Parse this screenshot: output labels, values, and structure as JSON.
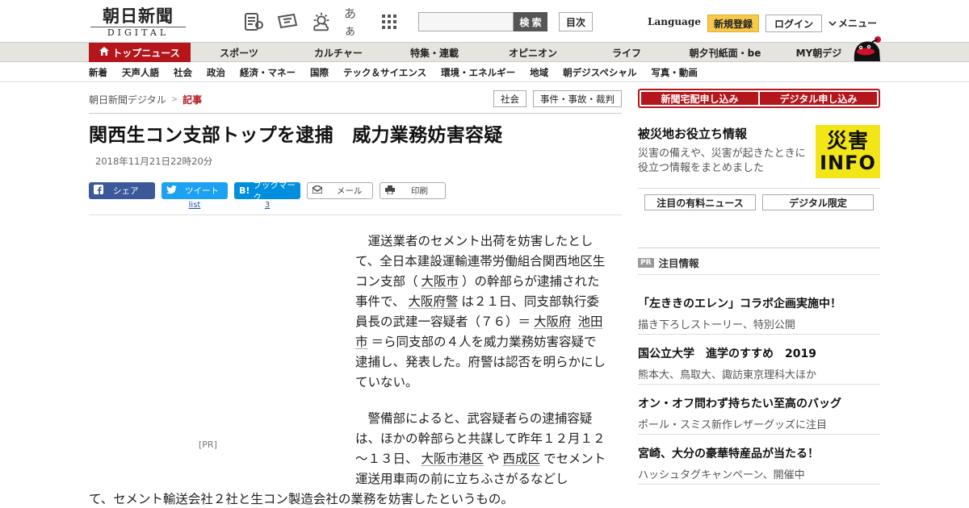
{
  "header": {
    "logo_main": "朝日新聞",
    "logo_sub": "DIGITAL",
    "search_button": "検 索",
    "index_button": "目次",
    "language": "Language",
    "signup": "新規登録",
    "login": "ログイン",
    "menu": "メニュー",
    "icon_font_label": "あぁ"
  },
  "nav_primary": [
    {
      "label": "トップニュース",
      "active": true
    },
    {
      "label": "スポーツ"
    },
    {
      "label": "カルチャー"
    },
    {
      "label": "特集・連載"
    },
    {
      "label": "オピニオン"
    },
    {
      "label": "ライフ"
    },
    {
      "label": "朝夕刊紙面・be"
    },
    {
      "label": "MY朝デジ"
    }
  ],
  "nav_secondary": [
    "新着",
    "天声人語",
    "社会",
    "政治",
    "経済・マネー",
    "国際",
    "テック＆サイエンス",
    "環境・エネルギー",
    "地域",
    "朝デジスペシャル",
    "写真・動画"
  ],
  "breadcrumb": {
    "home": "朝日新聞デジタル",
    "sep": ">",
    "current": "記事"
  },
  "category_tags": [
    "社会",
    "事件・事故・裁判"
  ],
  "article": {
    "headline": "関西生コン支部トップを逮捕　威力業務妨害容疑",
    "date": "2018年11月21日22時20分",
    "share": {
      "facebook": "シェア",
      "twitter": "ツイート",
      "twitter_count": "list",
      "hatena": "ブックマーク",
      "hatena_count": "3",
      "mail": "メール",
      "print": "印刷"
    },
    "ad_label": "[PR]",
    "p1": {
      "a": "運送業者のセメント出荷を妨害したとして、全日本建設運輸連帯労働組合関西地区生コン支部（",
      "k1": "大阪市",
      "b": "）の幹部らが逮捕された事件で、",
      "k2": "大阪府警",
      "c": "は２１日、同支部執行委員長の武建一容疑者（７６）＝",
      "k3": "大阪府",
      "k4": "池田市",
      "d": "＝ら同支部の４人を威力業務妨害容疑で逮捕し、発表した。府警は認否を明らかにしていない。"
    },
    "p2": {
      "a": "警備部によると、武容疑者らの逮捕容疑は、ほかの幹部らと共謀して昨年１２月１２～１３日、",
      "k1": "大阪市港区",
      "b": "や",
      "k2": "西成区",
      "c": "でセメント運送用車両の前に立ちふさがるなどし"
    },
    "tail": "て、セメント輸送会社２社と生コン製造会社の業務を妨害したというもの。"
  },
  "sidebar": {
    "subscribe_paper": "新聞宅配申し込み",
    "subscribe_digital": "デジタル申し込み",
    "disaster_title": "被災地お役立ち情報",
    "disaster_desc": "災害の備えや、災害が起きたときに役立つ情報をまとめました",
    "disaster_logo_1": "災害",
    "disaster_logo_2": "INFO",
    "tab_paid": "注目の有料ニュース",
    "tab_digital": "デジタル限定",
    "pr_badge": "PR",
    "pr_heading": "注目情報",
    "pr_items": [
      {
        "title": "「左ききのエレン」コラボ企画実施中！",
        "sub": "描き下ろしストーリー、特別公開"
      },
      {
        "title": "国公立大学　進学のすすめ　2019",
        "sub": "熊本大、鳥取大、諏訪東京理科大ほか"
      },
      {
        "title": "オン・オフ問わず持ちたい至高のバッグ",
        "sub": "ポール・スミス新作レザーグッズに注目"
      },
      {
        "title": "宮崎、大分の豪華特産品が当たる！",
        "sub": "ハッシュタグキャンペーン、開催中"
      }
    ]
  },
  "colors": {
    "brand_red": "#b4161c",
    "signup_yellow": "#f6c84b",
    "disaster_yellow": "#f2e617"
  }
}
